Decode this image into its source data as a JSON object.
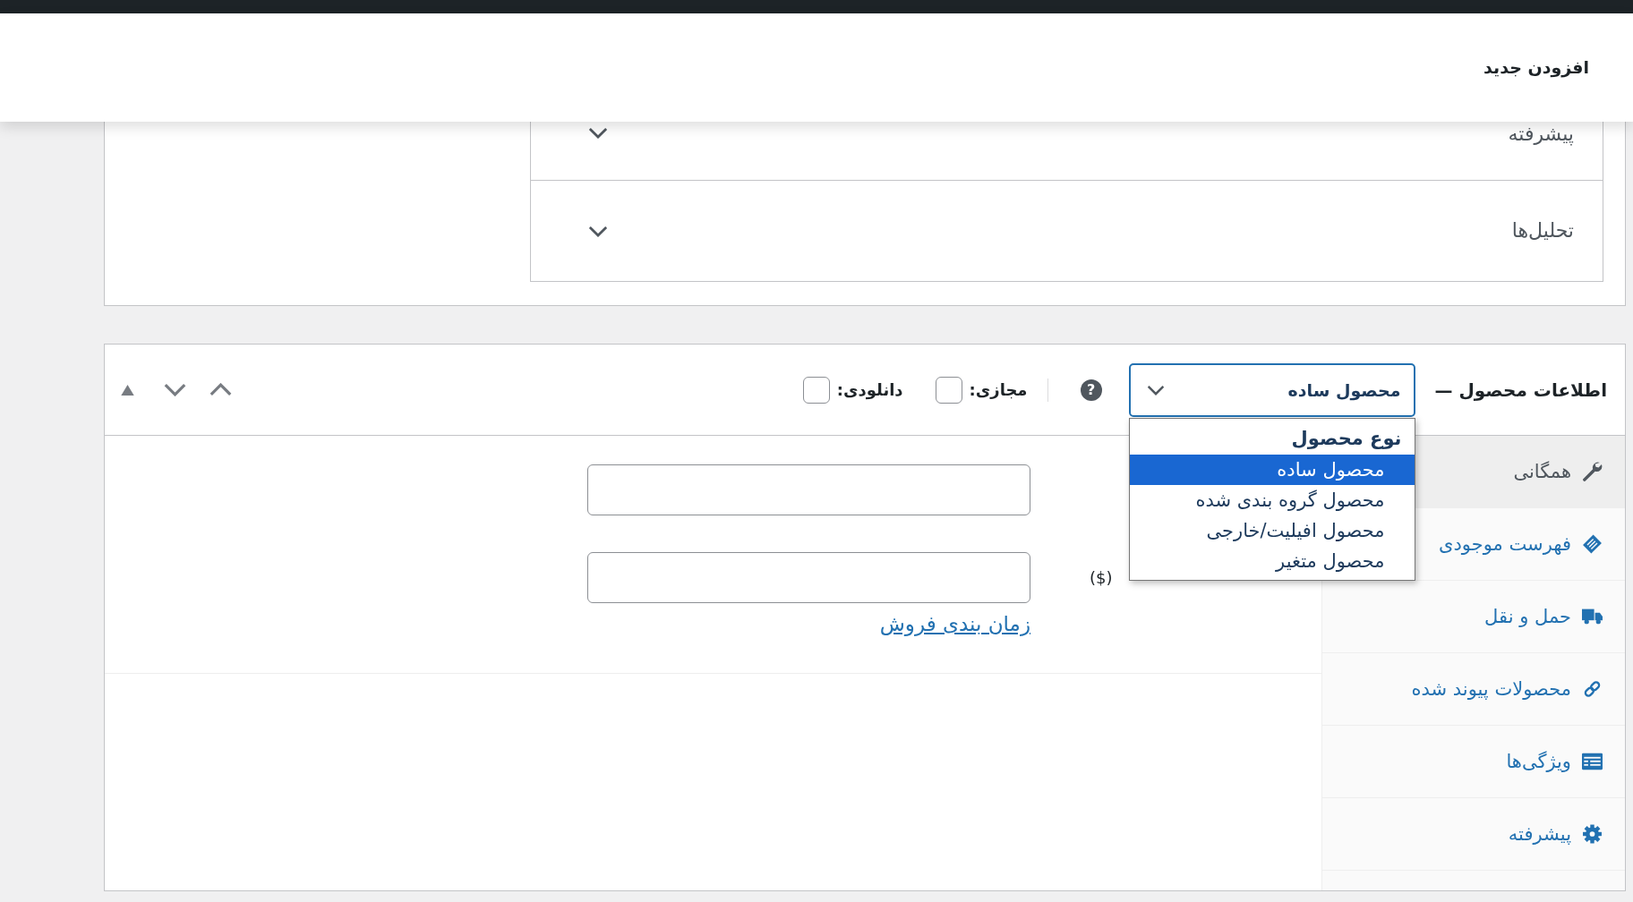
{
  "header": {
    "title": "افزودن جدید"
  },
  "sections": [
    {
      "label": "پیشرفته",
      "expanded": false
    },
    {
      "label": "تحلیل‌ها",
      "expanded": false
    }
  ],
  "product_data": {
    "title": "اطلاعات محصول —",
    "product_type": {
      "value": "محصول ساده",
      "open": true,
      "group": "نوع محصول",
      "options": [
        {
          "label": "محصول ساده",
          "selected": true
        },
        {
          "label": "محصول گروه بندی شده",
          "selected": false
        },
        {
          "label": "محصول افیلیت/خارجی",
          "selected": false
        },
        {
          "label": "محصول متغیر",
          "selected": false
        }
      ]
    },
    "help": "?",
    "options": [
      {
        "label": "مجازی:",
        "checked": false
      },
      {
        "label": "دانلودی:",
        "checked": false
      }
    ],
    "tabs": [
      {
        "label": "همگانی",
        "selected": true
      },
      {
        "label": "فهرست موجودی",
        "selected": false
      },
      {
        "label": "حمل و نقل",
        "selected": false
      },
      {
        "label": "محصولات پیوند شده",
        "selected": false
      },
      {
        "label": "ویژگی‌ها",
        "selected": false
      },
      {
        "label": "پیشرفته",
        "selected": false
      }
    ],
    "fields": [
      {
        "kind": "input"
      },
      {
        "kind": "input",
        "label": "($)"
      }
    ],
    "schedule_link": "زمان بندی فروش"
  }
}
